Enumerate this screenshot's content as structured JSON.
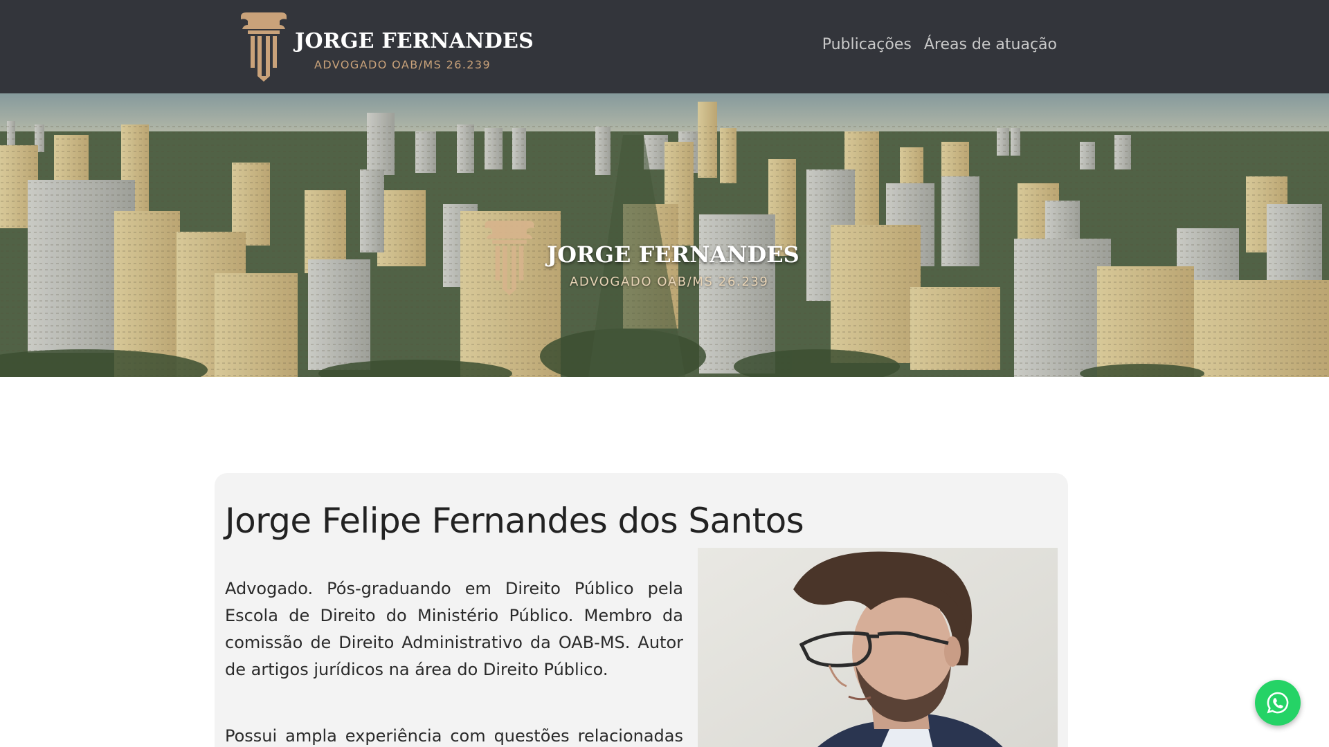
{
  "header": {
    "brand_name": "JORGE FERNANDES",
    "brand_subtitle": "ADVOGADO OAB/MS 26.239",
    "nav": [
      {
        "label": "Publicações"
      },
      {
        "label": "Áreas de atuação"
      }
    ]
  },
  "hero": {
    "brand_name": "JORGE FERNANDES",
    "brand_subtitle": "ADVOGADO OAB/MS 26.239"
  },
  "profile": {
    "name": "Jorge Felipe Fernandes dos Santos",
    "bio_1": "Advogado. Pós-graduando em Direito Público pela Escola de Direito do Ministério Público. Membro da comissão de Direito Administrativo da OAB-MS. Autor de artigos jurídicos na área do Direito Público.",
    "bio_2": "Possui ampla experiência com questões relacionadas ao"
  },
  "icons": {
    "logo": "column-pillar-logo",
    "whatsapp": "whatsapp-icon"
  },
  "colors": {
    "navbar": "#33353b",
    "gold": "#c9a27a",
    "card": "#f3f3f3",
    "whatsapp": "#25d366"
  }
}
